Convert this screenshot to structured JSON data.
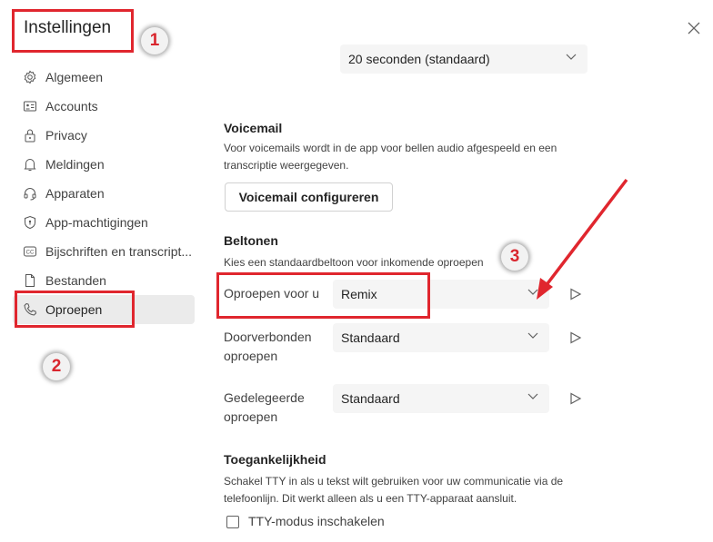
{
  "title": "Instellingen",
  "sidebar": {
    "items": [
      {
        "label": "Algemeen",
        "icon": "gear-icon"
      },
      {
        "label": "Accounts",
        "icon": "id-card-icon"
      },
      {
        "label": "Privacy",
        "icon": "lock-icon"
      },
      {
        "label": "Meldingen",
        "icon": "bell-icon"
      },
      {
        "label": "Apparaten",
        "icon": "headset-icon"
      },
      {
        "label": "App-machtigingen",
        "icon": "shield-icon"
      },
      {
        "label": "Bijschriften en transcript...",
        "icon": "cc-icon"
      },
      {
        "label": "Bestanden",
        "icon": "file-icon"
      },
      {
        "label": "Oproepen",
        "icon": "phone-icon",
        "selected": true
      }
    ]
  },
  "annotations": {
    "one": "1",
    "two": "2",
    "three": "3",
    "color": "#e0262e"
  },
  "main": {
    "top_dropdown": "20 seconden (standaard)",
    "voicemail": {
      "heading": "Voicemail",
      "description": "Voor voicemails wordt in de app voor bellen audio afgespeeld en een transcriptie weergegeven.",
      "button": "Voicemail configureren"
    },
    "ringtones": {
      "heading": "Beltonen",
      "description": "Kies een standaardbeltoon voor inkomende oproepen",
      "rows": [
        {
          "label": "Oproepen voor u",
          "value": "Remix"
        },
        {
          "label": "Doorverbonden oproepen",
          "value": "Standaard"
        },
        {
          "label": "Gedelegeerde oproepen",
          "value": "Standaard"
        }
      ]
    },
    "accessibility": {
      "heading": "Toegankelijkheid",
      "description": "Schakel TTY in als u tekst wilt gebruiken voor uw communicatie via de telefoonlijn. Dit werkt alleen als u een TTY-apparaat aansluit.",
      "checkbox": "TTY-modus inschakelen",
      "checked": false
    }
  }
}
